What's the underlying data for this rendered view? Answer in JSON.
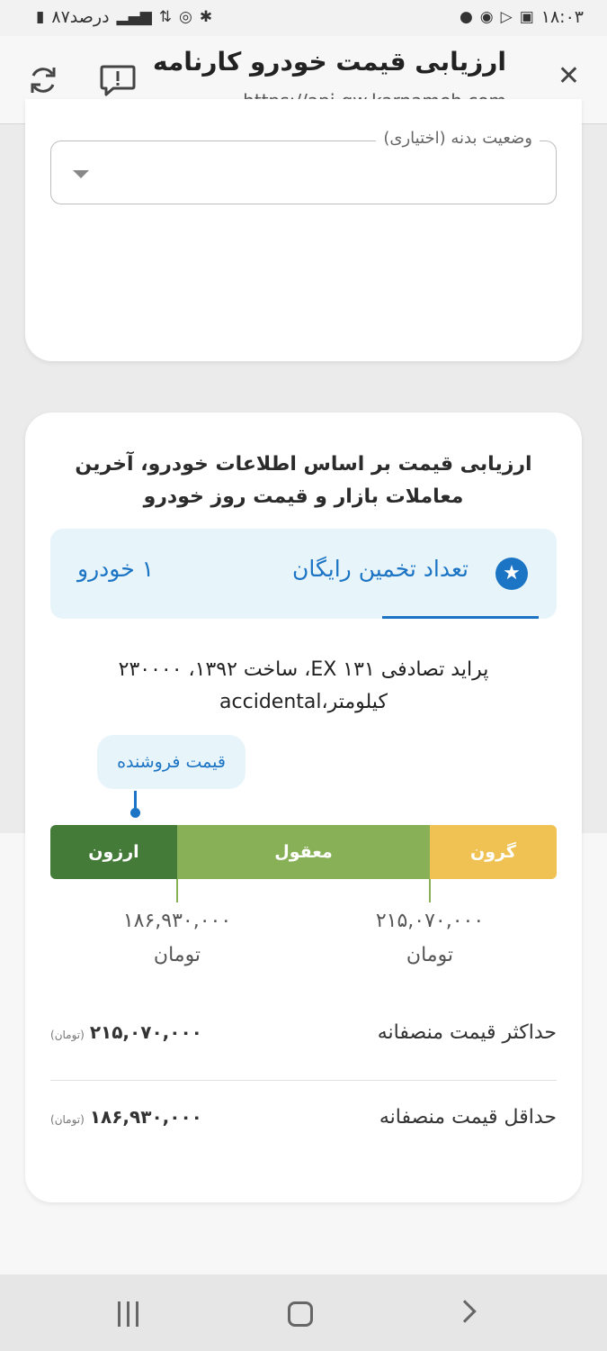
{
  "status_bar": {
    "time": "۱۸:۰۳",
    "battery_text": "۸۷درصد",
    "right_icons": [
      "gallery-icon",
      "play-store-icon",
      "vpn-icon",
      "dot-icon"
    ],
    "left_icons": [
      "bluetooth-icon",
      "hotspot-icon",
      "data-arrows-icon",
      "signal-icon"
    ]
  },
  "browser": {
    "title": "ارزیابی قیمت خودرو کارنامه",
    "url": "https://api-gw.karnameh.com"
  },
  "body_condition": {
    "label": "وضعیت بدنه (اختیاری)",
    "value": ""
  },
  "evaluation": {
    "intro": "ارزیابی قیمت بر اساس اطلاعات خودرو، آخرین معاملات بازار و قیمت روز خودرو",
    "free_estimates_label": "تعداد تخمین رایگان",
    "free_estimates_count": "۱ خودرو",
    "car_description": "پراید تصادفی EX ۱۳۱، ساخت ۱۳۹۲، ۲۳۰۰۰۰ کیلومتر،accidental",
    "seller_price_label": "قیمت فروشنده",
    "segments": {
      "cheap": "ارزون",
      "fair": "معقول",
      "expensive": "گرون"
    },
    "ticks": {
      "low_value": "۱۸۶,۹۳۰,۰۰۰",
      "high_value": "۲۱۵,۰۷۰,۰۰۰",
      "unit": "تومان"
    },
    "max_fair_price": {
      "label": "حداکثر قیمت منصفانه",
      "value": "۲۱۵,۰۷۰,۰۰۰",
      "unit": "(تومان)"
    },
    "min_fair_price": {
      "label": "حداقل قیمت منصفانه",
      "value": "۱۸۶,۹۳۰,۰۰۰",
      "unit": "(تومان)"
    }
  },
  "colors": {
    "accent": "#1c74c4",
    "cheap": "#447b39",
    "fair": "#88b057",
    "expensive": "#efc253"
  }
}
